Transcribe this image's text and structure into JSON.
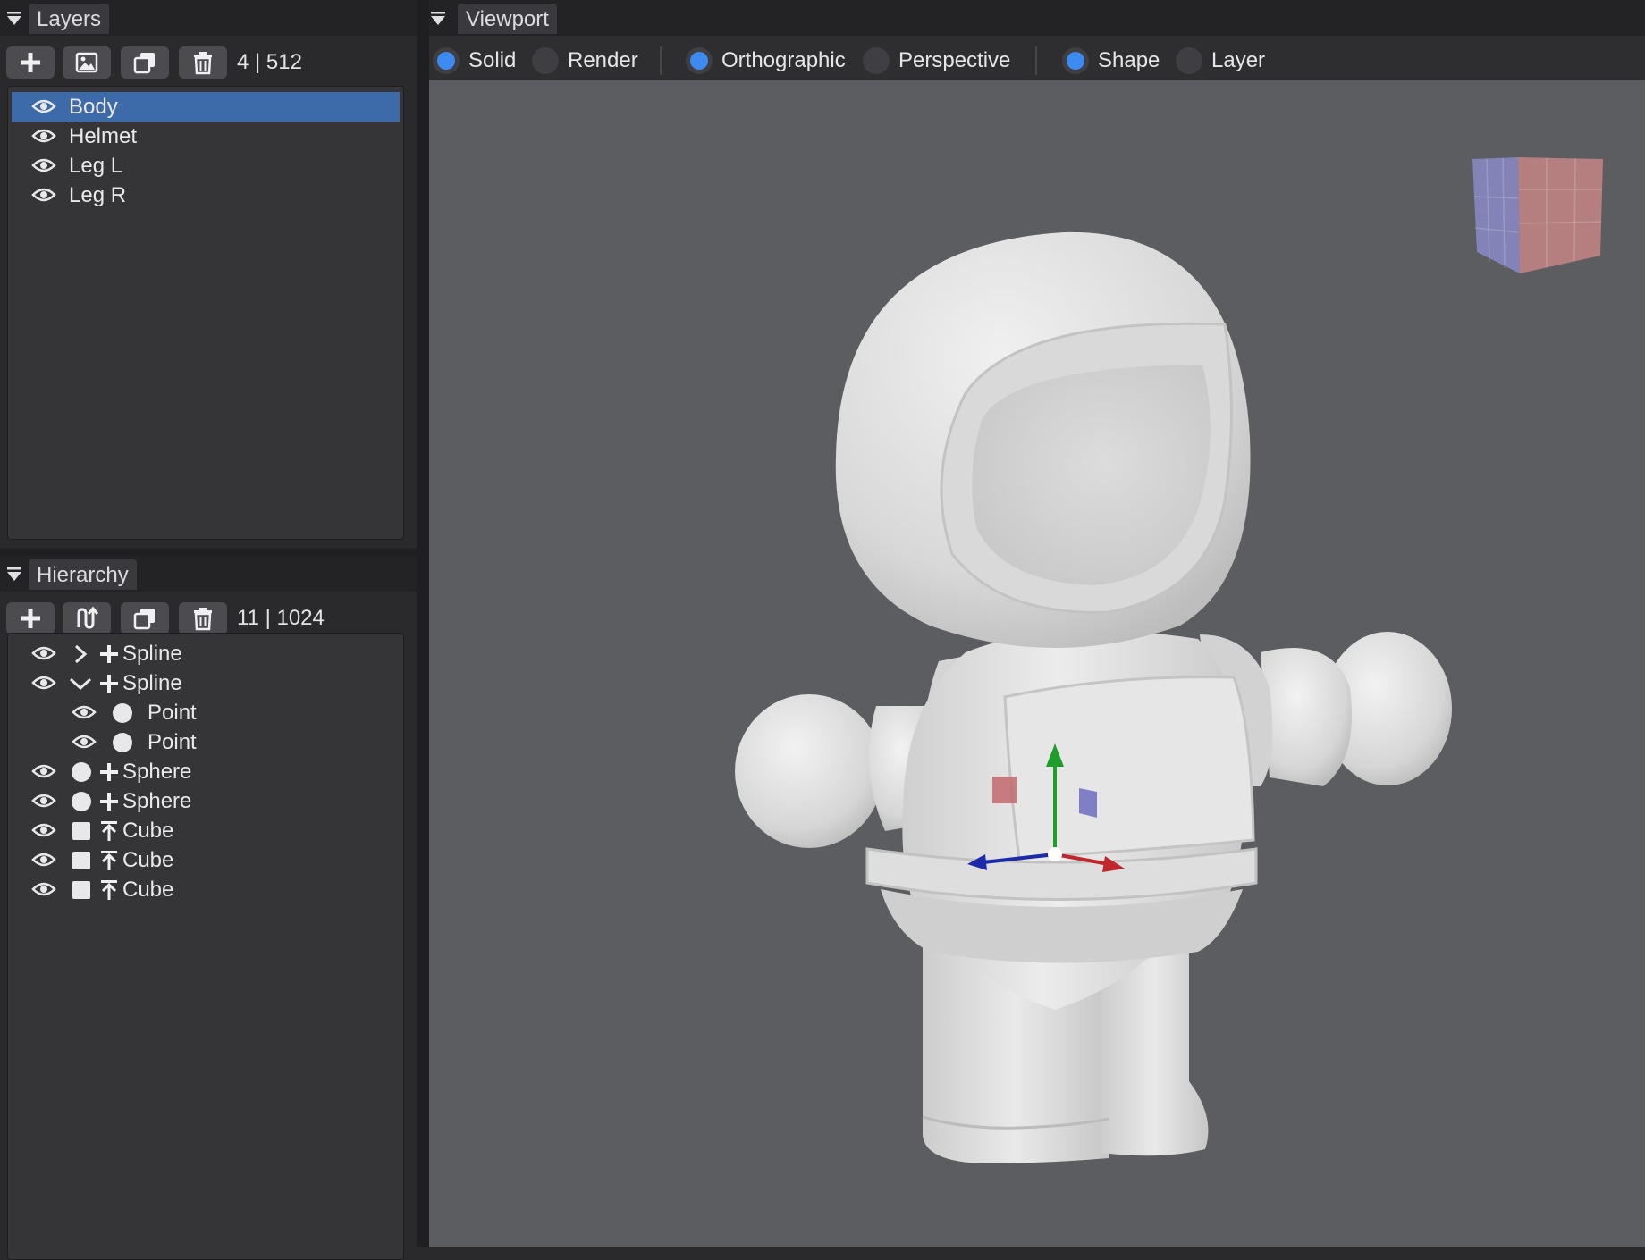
{
  "layers_panel": {
    "tab_label": "Layers",
    "count": "4 | 512",
    "toolbar": [
      "add-icon",
      "image-icon",
      "duplicate-icon",
      "trash-icon"
    ],
    "items": [
      {
        "label": "Body",
        "selected": true
      },
      {
        "label": "Helmet",
        "selected": false
      },
      {
        "label": "Leg L",
        "selected": false
      },
      {
        "label": "Leg R",
        "selected": false
      }
    ]
  },
  "hierarchy_panel": {
    "tab_label": "Hierarchy",
    "count": "11 | 1024",
    "toolbar": [
      "add-icon",
      "spline-icon",
      "duplicate-icon",
      "trash-icon"
    ],
    "items": [
      {
        "label": "Spline",
        "expander": "collapsed",
        "type_icon": "plus-icon",
        "depth": 0
      },
      {
        "label": "Spline",
        "expander": "expanded",
        "type_icon": "plus-icon",
        "depth": 0
      },
      {
        "label": "Point",
        "expander": "none",
        "type_icon": "circle-icon",
        "depth": 1
      },
      {
        "label": "Point",
        "expander": "none",
        "type_icon": "circle-icon",
        "depth": 1
      },
      {
        "label": "Sphere",
        "expander": "circle",
        "type_icon": "plus-icon",
        "depth": 0
      },
      {
        "label": "Sphere",
        "expander": "circle",
        "type_icon": "plus-icon",
        "depth": 0
      },
      {
        "label": "Cube",
        "expander": "square",
        "type_icon": "arrow-up-bar-icon",
        "depth": 0
      },
      {
        "label": "Cube",
        "expander": "square",
        "type_icon": "arrow-up-bar-icon",
        "depth": 0
      },
      {
        "label": "Cube",
        "expander": "square",
        "type_icon": "arrow-up-bar-icon",
        "depth": 0
      }
    ]
  },
  "viewport": {
    "tab_label": "Viewport",
    "shading": {
      "options": [
        "Solid",
        "Render"
      ],
      "selected": "Solid"
    },
    "projection": {
      "options": [
        "Orthographic",
        "Perspective"
      ],
      "selected": "Orthographic"
    },
    "display": {
      "options": [
        "Shape",
        "Layer"
      ],
      "selected": "Shape"
    },
    "colors": {
      "background": "#5c5d61",
      "accent": "#3d8bf0",
      "axis_x": "#c0262b",
      "axis_y": "#1f9e2c",
      "axis_z": "#1a2aa8"
    }
  }
}
